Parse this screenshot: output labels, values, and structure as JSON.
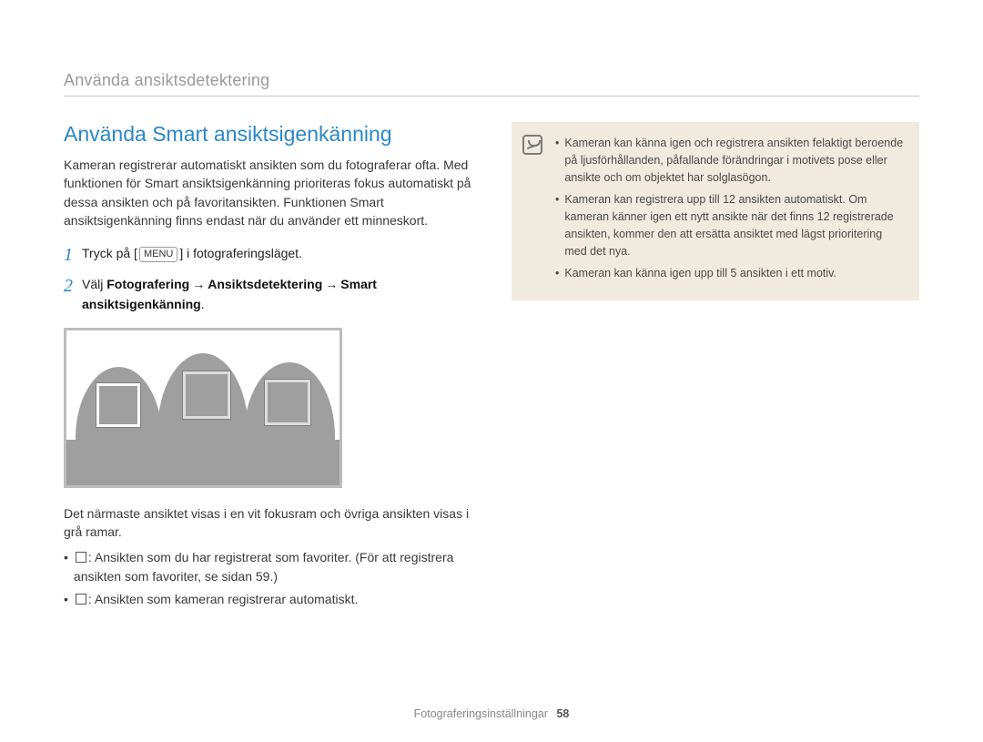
{
  "header": {
    "breadcrumb": "Använda ansiktsdetektering"
  },
  "section": {
    "title": "Använda Smart ansiktsigenkänning",
    "intro": "Kameran registrerar automatiskt ansikten som du fotograferar ofta. Med funktionen för Smart ansiktsigenkänning prioriteras fokus automatiskt på dessa ansikten och på favoritansikten. Funktionen Smart ansiktsigenkänning finns endast när du använder ett minneskort."
  },
  "steps": {
    "one": {
      "num": "1",
      "pre": "Tryck på [",
      "chip": "MENU",
      "post": "] i fotograferingsläget."
    },
    "two": {
      "num": "2",
      "lead": "Välj ",
      "b1": "Fotografering",
      "arrow": "→",
      "b2": "Ansiktsdetektering",
      "b3": "Smart ansiktsigenkänning",
      "tail": "."
    }
  },
  "afterimg": {
    "line": "Det närmaste ansiktet visas i en vit fokusram och övriga ansikten visas i grå ramar.",
    "b1": ": Ansikten som du har registrerat som favoriter. (För att registrera ansikten som favoriter, se sidan 59.)",
    "b2": ": Ansikten som kameran registrerar automatiskt."
  },
  "info": {
    "items": [
      "Kameran kan känna igen och registrera ansikten felaktigt beroende på ljusförhållanden, påfallande förändringar i motivets pose eller ansikte och om objektet har solglasögon.",
      "Kameran kan registrera upp till 12 ansikten automatiskt. Om kameran känner igen ett nytt ansikte när det finns 12 registrerade ansikten, kommer den att ersätta ansiktet med lägst prioritering med det nya.",
      "Kameran kan känna igen upp till 5 ansikten i ett motiv."
    ]
  },
  "footer": {
    "label": "Fotograferingsinställningar",
    "page": "58"
  }
}
